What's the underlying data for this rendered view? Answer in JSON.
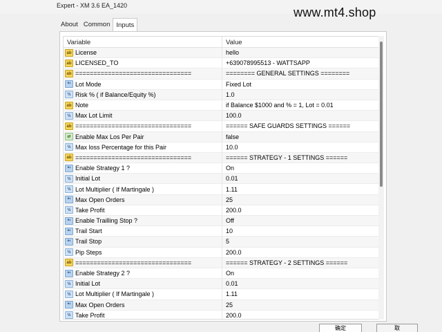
{
  "window": {
    "title": "Expert - XM 3.6 EA_1420",
    "watermark": "www.mt4.shop"
  },
  "tabs": [
    {
      "label": "About"
    },
    {
      "label": "Common"
    },
    {
      "label": "Inputs"
    }
  ],
  "table": {
    "headers": {
      "variable": "Variable",
      "value": "Value"
    },
    "rows": [
      {
        "icon": "ab",
        "name": "License",
        "value": "hello"
      },
      {
        "icon": "ab",
        "name": "LICENSED_TO",
        "value": "+639078995513 - WATTSAPP"
      },
      {
        "icon": "ab",
        "name": "================================",
        "value": "======== GENERAL SETTINGS ========"
      },
      {
        "icon": "enum",
        "name": "Lot Mode",
        "value": "Fixed Lot"
      },
      {
        "icon": "num",
        "name": "Risk % ( if Balance/Equity %)",
        "value": "1.0"
      },
      {
        "icon": "ab",
        "name": "Note",
        "value": "if Balance $1000 and % = 1, Lot = 0.01"
      },
      {
        "icon": "num",
        "name": "Max Lot Limit",
        "value": "100.0"
      },
      {
        "icon": "ab",
        "name": "================================",
        "value": "====== SAFE GUARDS SETTINGS ======"
      },
      {
        "icon": "bool",
        "name": "Enable Max Los Per Pair",
        "value": "false"
      },
      {
        "icon": "num",
        "name": "Max loss Percentage for this Pair",
        "value": "10.0"
      },
      {
        "icon": "ab",
        "name": "================================",
        "value": "====== STRATEGY - 1 SETTINGS ======"
      },
      {
        "icon": "enum",
        "name": "Enable Strategy 1 ?",
        "value": "On"
      },
      {
        "icon": "num",
        "name": "Initial Lot",
        "value": "0.01"
      },
      {
        "icon": "num",
        "name": "Lot Multiplier ( If Martingale )",
        "value": "1.11"
      },
      {
        "icon": "enum",
        "name": "Max Open Orders",
        "value": "25"
      },
      {
        "icon": "num",
        "name": "Take Profit",
        "value": "200.0"
      },
      {
        "icon": "enum",
        "name": "Enable Trailling Stop ?",
        "value": "Off"
      },
      {
        "icon": "enum",
        "name": "Trail Start",
        "value": "10"
      },
      {
        "icon": "enum",
        "name": "Trail Stop",
        "value": "5"
      },
      {
        "icon": "num",
        "name": "Pip Steps",
        "value": "200.0"
      },
      {
        "icon": "ab",
        "name": "================================",
        "value": "====== STRATEGY - 2 SETTINGS ======"
      },
      {
        "icon": "enum",
        "name": "Enable Strategy 2 ?",
        "value": "On"
      },
      {
        "icon": "num",
        "name": "Initial Lot",
        "value": "0.01"
      },
      {
        "icon": "num",
        "name": "Lot Multiplier ( If Martingale )",
        "value": "1.11"
      },
      {
        "icon": "enum",
        "name": "Max Open Orders",
        "value": "25"
      },
      {
        "icon": "num",
        "name": "Take Profit",
        "value": "200.0"
      }
    ]
  },
  "buttons": {
    "ok": "确定",
    "cancel": "取"
  }
}
